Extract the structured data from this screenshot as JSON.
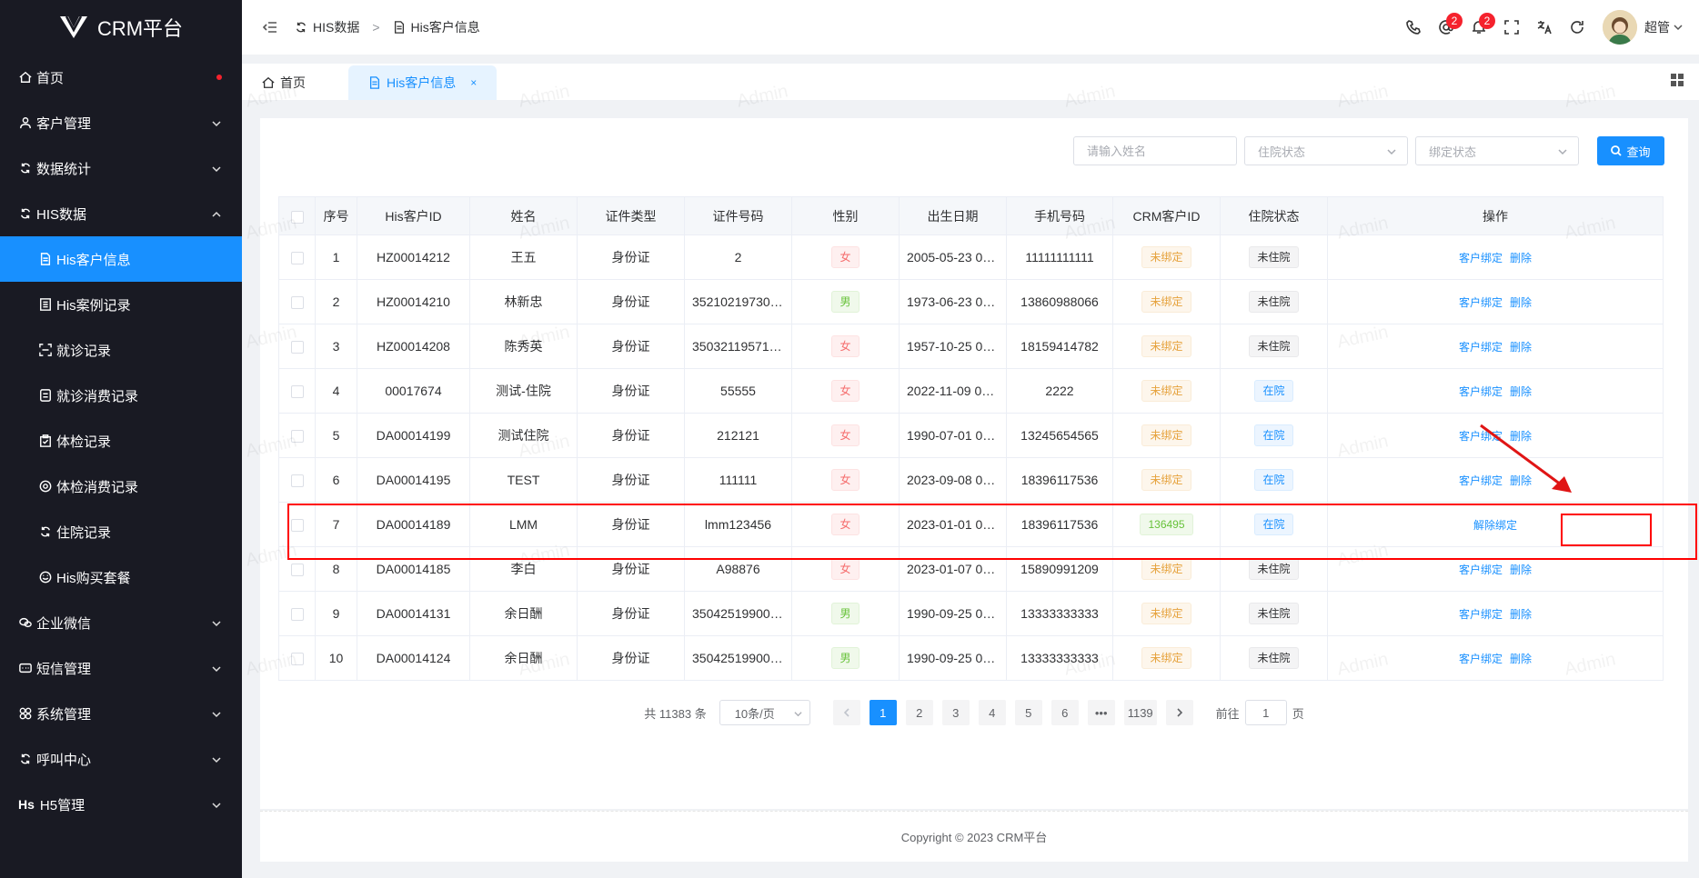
{
  "brand": {
    "name": "CRM平台"
  },
  "sidebar": {
    "items": [
      {
        "label": "首页",
        "icon": "home-icon",
        "dot": true
      },
      {
        "label": "客户管理",
        "icon": "user-icon",
        "expandable": true
      },
      {
        "label": "数据统计",
        "icon": "stats-icon",
        "expandable": true
      },
      {
        "label": "HIS数据",
        "icon": "sync-icon",
        "expandable": true,
        "expanded": true
      },
      {
        "label": "His客户信息",
        "icon": "document-icon",
        "sub": true,
        "active": true
      },
      {
        "label": "His案例记录",
        "icon": "list-icon",
        "sub": true
      },
      {
        "label": "就诊记录",
        "icon": "scan-icon",
        "sub": true
      },
      {
        "label": "就诊消费记录",
        "icon": "receipt-icon",
        "sub": true
      },
      {
        "label": "体检记录",
        "icon": "clipboard-icon",
        "sub": true
      },
      {
        "label": "体检消费记录",
        "icon": "target-icon",
        "sub": true
      },
      {
        "label": "住院记录",
        "icon": "hospital-icon",
        "sub": true
      },
      {
        "label": "His购买套餐",
        "icon": "package-icon",
        "sub": true
      },
      {
        "label": "企业微信",
        "icon": "wechat-icon",
        "expandable": true
      },
      {
        "label": "短信管理",
        "icon": "message-icon",
        "expandable": true
      },
      {
        "label": "系统管理",
        "icon": "grid-icon",
        "expandable": true
      },
      {
        "label": "呼叫中心",
        "icon": "phone-sync-icon",
        "expandable": true
      },
      {
        "label": "H5管理",
        "icon": "h5-icon",
        "icon_text": "Hs",
        "expandable": true
      }
    ]
  },
  "header": {
    "breadcrumb": [
      "HIS数据",
      "His客户信息"
    ],
    "breadcrumb_sep": ">",
    "mention_count": "2",
    "notify_count": "2",
    "user_name": "超管"
  },
  "tabs": [
    {
      "label": "首页",
      "icon": "home-icon"
    },
    {
      "label": "His客户信息",
      "icon": "document-icon",
      "active": true,
      "close": "×"
    }
  ],
  "filters": {
    "name_placeholder": "请输入姓名",
    "status_placeholder": "住院状态",
    "bind_placeholder": "绑定状态",
    "query_label": "查询"
  },
  "table": {
    "columns": [
      "序号",
      "His客户ID",
      "姓名",
      "证件类型",
      "证件号码",
      "性别",
      "出生日期",
      "手机号码",
      "CRM客户ID",
      "住院状态",
      "操作"
    ],
    "action_bind": "客户绑定",
    "action_delete": "删除",
    "action_unbind": "解除绑定",
    "rows": [
      {
        "no": "1",
        "his_id": "HZ00014212",
        "name": "王五",
        "id_type": "身份证",
        "id_no": "2",
        "gender": "女",
        "birth": "2005-05-23 00:0...",
        "phone": "11111111111",
        "crm_id": "未绑定",
        "crm_bound": false,
        "status": "未住院",
        "inpatient": false
      },
      {
        "no": "2",
        "his_id": "HZ00014210",
        "name": "林新忠",
        "id_type": "身份证",
        "id_no": "3521021973062...",
        "gender": "男",
        "birth": "1973-06-23 00:0...",
        "phone": "13860988066",
        "crm_id": "未绑定",
        "crm_bound": false,
        "status": "未住院",
        "inpatient": false
      },
      {
        "no": "3",
        "his_id": "HZ00014208",
        "name": "陈秀英",
        "id_type": "身份证",
        "id_no": "3503211957102...",
        "gender": "女",
        "birth": "1957-10-25 00:0...",
        "phone": "18159414782",
        "crm_id": "未绑定",
        "crm_bound": false,
        "status": "未住院",
        "inpatient": false
      },
      {
        "no": "4",
        "his_id": "00017674",
        "name": "测试-住院",
        "id_type": "身份证",
        "id_no": "55555",
        "gender": "女",
        "birth": "2022-11-09 00:0...",
        "phone": "2222",
        "crm_id": "未绑定",
        "crm_bound": false,
        "status": "在院",
        "inpatient": true
      },
      {
        "no": "5",
        "his_id": "DA00014199",
        "name": "测试住院",
        "id_type": "身份证",
        "id_no": "212121",
        "gender": "女",
        "birth": "1990-07-01 00:0...",
        "phone": "13245654565",
        "crm_id": "未绑定",
        "crm_bound": false,
        "status": "在院",
        "inpatient": true
      },
      {
        "no": "6",
        "his_id": "DA00014195",
        "name": "TEST",
        "id_type": "身份证",
        "id_no": "111111",
        "gender": "女",
        "birth": "2023-09-08 00:0...",
        "phone": "18396117536",
        "crm_id": "未绑定",
        "crm_bound": false,
        "status": "在院",
        "inpatient": true
      },
      {
        "no": "7",
        "his_id": "DA00014189",
        "name": "LMM",
        "id_type": "身份证",
        "id_no": "lmm123456",
        "gender": "女",
        "birth": "2023-01-01 00:0...",
        "phone": "18396117536",
        "crm_id": "136495",
        "crm_bound": true,
        "status": "在院",
        "inpatient": true
      },
      {
        "no": "8",
        "his_id": "DA00014185",
        "name": "李白",
        "id_type": "身份证",
        "id_no": "A98876",
        "gender": "女",
        "birth": "2023-01-07 00:0...",
        "phone": "15890991209",
        "crm_id": "未绑定",
        "crm_bound": false,
        "status": "未住院",
        "inpatient": false
      },
      {
        "no": "9",
        "his_id": "DA00014131",
        "name": "余日酬",
        "id_type": "身份证",
        "id_no": "3504251990092...",
        "gender": "男",
        "birth": "1990-09-25 00:0...",
        "phone": "13333333333",
        "crm_id": "未绑定",
        "crm_bound": false,
        "status": "未住院",
        "inpatient": false
      },
      {
        "no": "10",
        "his_id": "DA00014124",
        "name": "余日酬",
        "id_type": "身份证",
        "id_no": "3504251990092...",
        "gender": "男",
        "birth": "1990-09-25 00:0...",
        "phone": "13333333333",
        "crm_id": "未绑定",
        "crm_bound": false,
        "status": "未住院",
        "inpatient": false
      }
    ]
  },
  "pagination": {
    "total_text": "共 11383 条",
    "page_size": "10条/页",
    "pages": [
      "1",
      "2",
      "3",
      "4",
      "5",
      "6",
      "•••",
      "1139"
    ],
    "current": "1",
    "goto_label": "前往",
    "goto_value": "1",
    "page_suffix": "页"
  },
  "footer": {
    "text": "Copyright © 2023 CRM平台"
  },
  "watermark": "Admin",
  "colors": {
    "primary": "#1890ff",
    "sidebar_bg": "#191a23",
    "annotation": "#ff0000"
  }
}
